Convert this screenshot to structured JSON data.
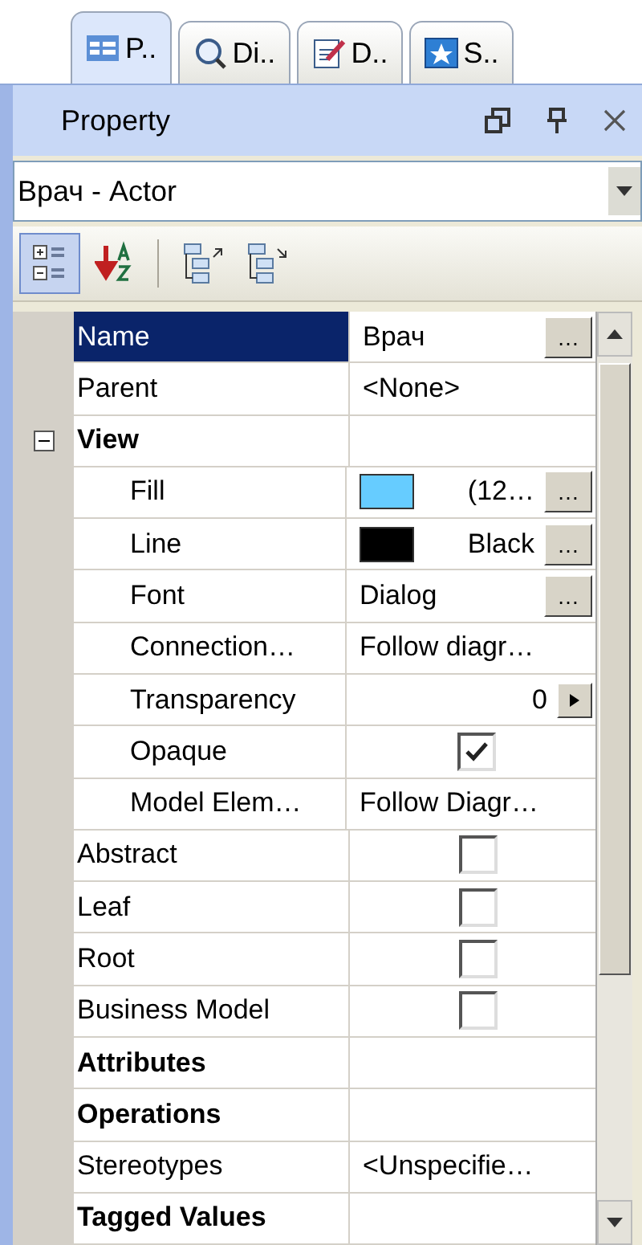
{
  "tabs": [
    {
      "label": "P..",
      "selected": true
    },
    {
      "label": "Di..",
      "selected": false
    },
    {
      "label": "D..",
      "selected": false
    },
    {
      "label": "S..",
      "selected": false
    }
  ],
  "panel": {
    "title": "Property"
  },
  "object_selector": {
    "value": "Врач - Actor"
  },
  "toolbar": [
    {
      "selected": true
    },
    {
      "selected": false
    },
    {
      "selected": false
    },
    {
      "selected": false
    }
  ],
  "properties": [
    {
      "name": "Name",
      "value": "Врач",
      "kind": "button",
      "button": "…",
      "selected": true
    },
    {
      "name": "Parent",
      "value": "<None>",
      "kind": "text",
      "selected": false
    },
    {
      "name": "View",
      "kind": "category",
      "expanded": true,
      "selected": false,
      "children": [
        {
          "name": "Fill",
          "value": "(12…",
          "kind": "color",
          "color": "#66ccff",
          "button": "…",
          "selected": false
        },
        {
          "name": "Line",
          "value": "Black",
          "kind": "color",
          "color": "#000000",
          "button": "…",
          "selected": false
        },
        {
          "name": "Font",
          "value": "Dialog",
          "kind": "button",
          "button": "…",
          "selected": false
        },
        {
          "name": "Connection…",
          "value": "Follow diagr…",
          "kind": "text",
          "selected": false
        },
        {
          "name": "Transparency",
          "value": "0",
          "kind": "number",
          "selected": false
        },
        {
          "name": "Opaque",
          "kind": "checkbox",
          "checked": true,
          "selected": false
        },
        {
          "name": "Model Elem…",
          "value": "Follow Diagr…",
          "kind": "text",
          "selected": false
        }
      ]
    },
    {
      "name": "Abstract",
      "kind": "checkbox",
      "checked": false,
      "selected": false
    },
    {
      "name": "Leaf",
      "kind": "checkbox",
      "checked": false,
      "selected": false
    },
    {
      "name": "Root",
      "kind": "checkbox",
      "checked": false,
      "selected": false
    },
    {
      "name": "Business Model",
      "kind": "checkbox",
      "checked": false,
      "selected": false
    },
    {
      "name": "Attributes",
      "kind": "category",
      "selected": false
    },
    {
      "name": "Operations",
      "kind": "category",
      "selected": false
    },
    {
      "name": "Stereotypes",
      "value": "<Unspecifie…",
      "kind": "text",
      "selected": false
    },
    {
      "name": "Tagged Values",
      "kind": "category",
      "selected": false
    }
  ]
}
